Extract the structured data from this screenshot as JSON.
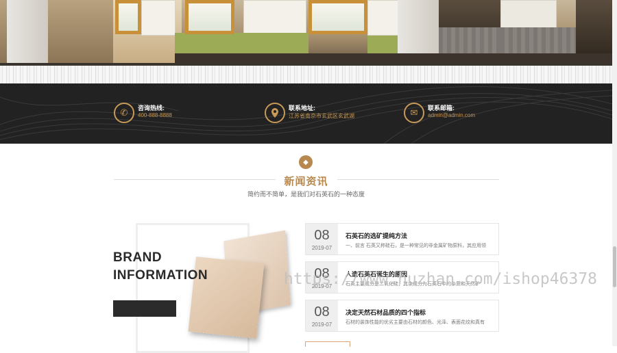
{
  "contact": {
    "items": [
      {
        "icon": "phone-icon",
        "title": "咨询热线:",
        "value": "400-888-8888"
      },
      {
        "icon": "location-pin-icon",
        "title": "联系地址:",
        "value": "江苏省南京市玄武区玄武湖"
      },
      {
        "icon": "envelope-icon",
        "title": "联系邮箱:",
        "value": "admin@admin.com"
      }
    ]
  },
  "news": {
    "title": "新闻资讯",
    "subtitle": "简约而不简单，是我们对石英石的一种态度",
    "brand_line1": "BRAND",
    "brand_line2": "INFORMATION",
    "items": [
      {
        "day": "08",
        "ym": "2019-07",
        "title": "石英石的选矿提纯方法",
        "desc": "一、前言 石英又称硅石，是一种常见的非金属矿物原料，其应用领"
      },
      {
        "day": "08",
        "ym": "2019-07",
        "title": "人造石英石诞生的原因",
        "desc": "石英主要成分是二氧化硅，其余成分为石英石中的杂质和天然矿"
      },
      {
        "day": "08",
        "ym": "2019-07",
        "title": "决定天然石材品质的四个指标",
        "desc": "石材的装饰性能的优劣主要由石材的颜色、光泽、表面花纹和真有"
      }
    ]
  },
  "watermark": "https://www.huzhan.com/ishop46378",
  "colors": {
    "accent": "#b8894f",
    "dark_band": "#222222"
  }
}
